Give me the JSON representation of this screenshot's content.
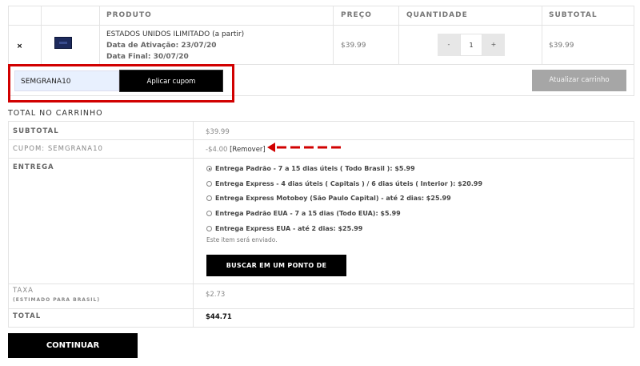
{
  "cart_table": {
    "headers": {
      "product": "PRODUTO",
      "price": "PREÇO",
      "quantity": "QUANTIDADE",
      "subtotal": "SUBTOTAL"
    },
    "row": {
      "remove_icon": "close-icon",
      "product_name": "ESTADOS UNIDOS ILIMITADO (a partir)",
      "activation_label": "Data de Ativação:",
      "activation_date": "23/07/20",
      "final_label": "Data Final:",
      "final_date": "30/07/20",
      "price": "$39.99",
      "qty_minus": "-",
      "qty_value": "1",
      "qty_plus": "+",
      "subtotal": "$39.99"
    }
  },
  "coupon": {
    "code": "SEMGRANA10",
    "apply_label": "Aplicar cupom"
  },
  "update_cart_label": "Atualizar carrinho",
  "totals": {
    "title": "TOTAL NO CARRINHO",
    "subtotal_label": "SUBTOTAL",
    "subtotal_value": "$39.99",
    "coupon_label": "CUPOM: SEMGRANA10",
    "coupon_value": "-$4.00",
    "coupon_remove": "[Remover]",
    "shipping_label": "ENTREGA",
    "shipping_options": [
      {
        "label": "Entrega Padrão - 7 a 15 dias úteis ( Todo Brasil ): $5.99",
        "selected": true
      },
      {
        "label": "Entrega Express - 4 dias úteis ( Capitais ) / 6 dias úteis ( Interior ): $20.99",
        "selected": false
      },
      {
        "label": "Entrega Express Motoboy (São Paulo Capital) - até 2 dias: $25.99",
        "selected": false
      },
      {
        "label": "Entrega Padrão EUA - 7 a 15 dias (Todo EUA): $5.99",
        "selected": false
      },
      {
        "label": "Entrega Express EUA - até 2 dias: $25.99",
        "selected": false
      }
    ],
    "shipping_note": "Este item será enviado.",
    "pickup_label": "BUSCAR EM UM PONTO DE RETIRADA.",
    "tax_label": "TAXA",
    "tax_sublabel": "(ESTIMADO PARA BRASIL)",
    "tax_value": "$2.73",
    "total_label": "TOTAL",
    "total_value": "$44.71"
  },
  "continue_label": "CONTINUAR",
  "colors": {
    "highlight": "#d10000",
    "button": "#000000",
    "update_button": "#a6a6a6"
  }
}
